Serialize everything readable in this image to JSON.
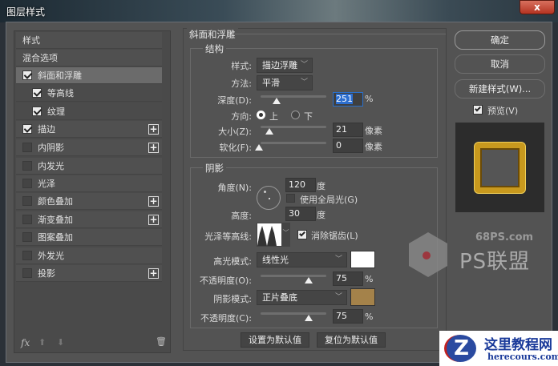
{
  "window": {
    "title": "图层样式",
    "close": "x"
  },
  "left": {
    "items": [
      {
        "label": "样式",
        "checkbox": null,
        "plus": false
      },
      {
        "label": "混合选项",
        "checkbox": null,
        "plus": false
      },
      {
        "label": "斜面和浮雕",
        "checkbox": true,
        "plus": false,
        "selected": true
      },
      {
        "label": "等高线",
        "checkbox": true,
        "plus": false,
        "sub": true
      },
      {
        "label": "纹理",
        "checkbox": true,
        "plus": false,
        "sub": true
      },
      {
        "label": "描边",
        "checkbox": true,
        "plus": true
      },
      {
        "label": "内阴影",
        "checkbox": false,
        "plus": true
      },
      {
        "label": "内发光",
        "checkbox": false,
        "plus": false
      },
      {
        "label": "光泽",
        "checkbox": false,
        "plus": false
      },
      {
        "label": "颜色叠加",
        "checkbox": false,
        "plus": true
      },
      {
        "label": "渐变叠加",
        "checkbox": false,
        "plus": true
      },
      {
        "label": "图案叠加",
        "checkbox": false,
        "plus": false
      },
      {
        "label": "外发光",
        "checkbox": false,
        "plus": false
      },
      {
        "label": "投影",
        "checkbox": false,
        "plus": true
      }
    ],
    "footer": {
      "fx": "fx",
      "up": "⬆",
      "down": "⬇",
      "trash": "🗑"
    }
  },
  "bevel": {
    "title": "斜面和浮雕",
    "structure": {
      "title": "结构",
      "style_label": "样式:",
      "style_value": "描边浮雕",
      "method_label": "方法:",
      "method_value": "平滑",
      "depth_label": "深度(D):",
      "depth_value": "251",
      "depth_unit": "%",
      "direction_label": "方向:",
      "dir_up": "上",
      "dir_down": "下",
      "direction": "up",
      "size_label": "大小(Z):",
      "size_value": "21",
      "size_unit": "像素",
      "soften_label": "软化(F):",
      "soften_value": "0",
      "soften_unit": "像素"
    },
    "shading": {
      "title": "阴影",
      "angle_label": "角度(N):",
      "angle_value": "120",
      "angle_unit": "度",
      "global_light_label": "使用全局光(G)",
      "global_light": false,
      "altitude_label": "高度:",
      "altitude_value": "30",
      "altitude_unit": "度",
      "gloss_label": "光泽等高线:",
      "antialias_label": "消除锯齿(L)",
      "antialias": true,
      "highlight_mode_label": "高光模式:",
      "highlight_mode": "线性光",
      "highlight_color": "#ffffff",
      "highlight_opacity_label": "不透明度(O):",
      "highlight_opacity": "75",
      "highlight_opacity_unit": "%",
      "shadow_mode_label": "阴影模式:",
      "shadow_mode": "正片叠底",
      "shadow_color": "#a4824a",
      "shadow_opacity_label": "不透明度(C):",
      "shadow_opacity": "75",
      "shadow_opacity_unit": "%"
    },
    "make_default": "设置为默认值",
    "reset_default": "复位为默认值"
  },
  "right": {
    "ok": "确定",
    "cancel": "取消",
    "new_style": "新建样式(W)...",
    "preview_label": "预览(V)",
    "preview": true
  },
  "watermarks": {
    "ps": "68PS.com",
    "ps_logo": "PS联盟",
    "site": "这里教程网",
    "site_url": "herecours.com"
  }
}
